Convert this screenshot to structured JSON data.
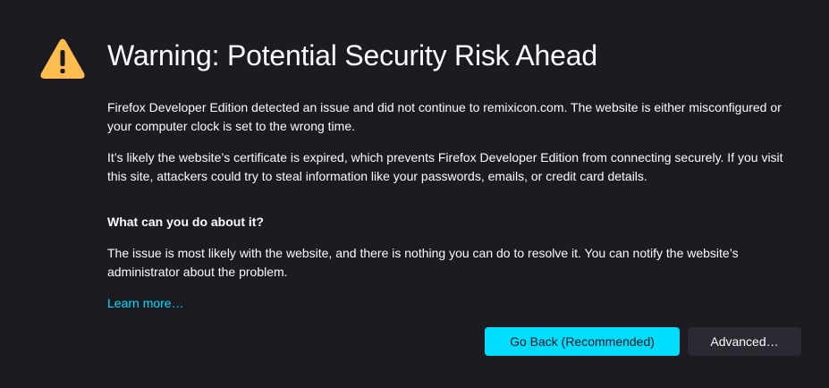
{
  "page": {
    "title": "Warning: Potential Security Risk Ahead",
    "intro": "Firefox Developer Edition detected an issue and did not continue to remixicon.com. The website is either misconfigured or your computer clock is set to the wrong time.",
    "details": "It’s likely the website’s certificate is expired, which prevents Firefox Developer Edition from connecting securely. If you visit this site, attackers could try to steal information like your passwords, emails, or credit card details.",
    "what_heading": "What can you do about it?",
    "what_body": "The issue is most likely with the website, and there is nothing you can do to resolve it. You can notify the website’s administrator about the problem.",
    "learn_more": "Learn more…"
  },
  "buttons": {
    "go_back": "Go Back (Recommended)",
    "advanced": "Advanced…"
  },
  "icons": {
    "warning": "warning-icon"
  },
  "colors": {
    "background": "#1c1b22",
    "text": "#fbfbfe",
    "accent": "#00ddff",
    "warning": "#ffbd4f",
    "secondary_button": "#2b2a33"
  }
}
